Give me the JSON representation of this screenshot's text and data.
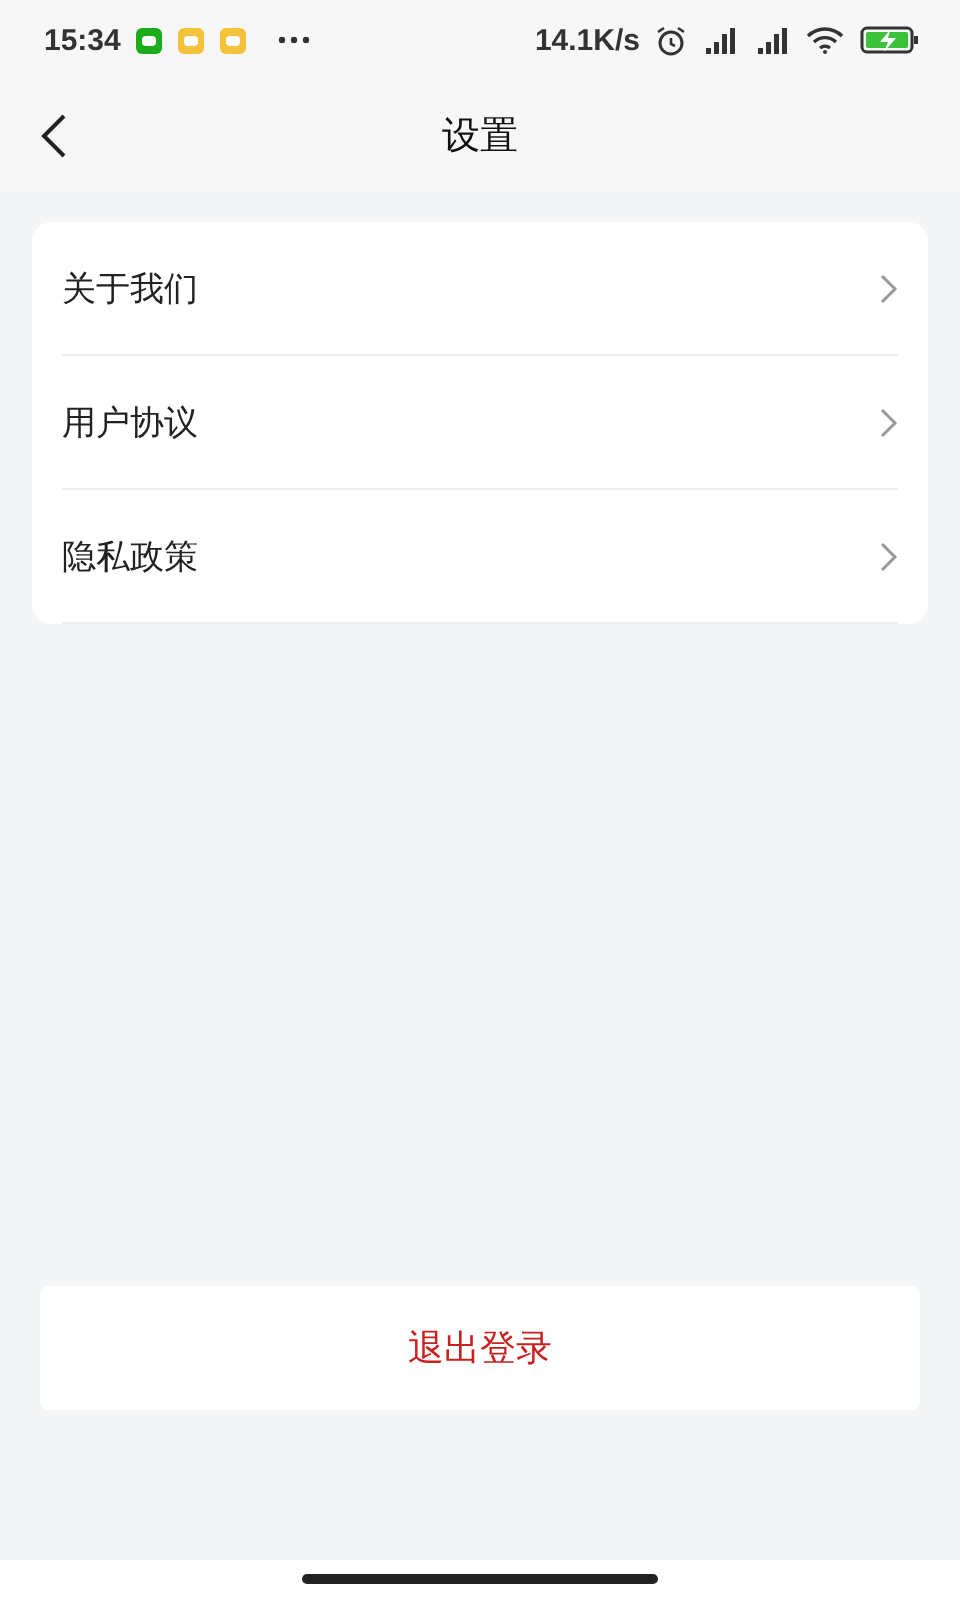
{
  "status_bar": {
    "time": "15:34",
    "net_speed": "14.1K/s"
  },
  "header": {
    "title": "设置"
  },
  "menu": [
    {
      "label": "关于我们"
    },
    {
      "label": "用户协议"
    },
    {
      "label": "隐私政策"
    }
  ],
  "logout_button": "退出登录"
}
